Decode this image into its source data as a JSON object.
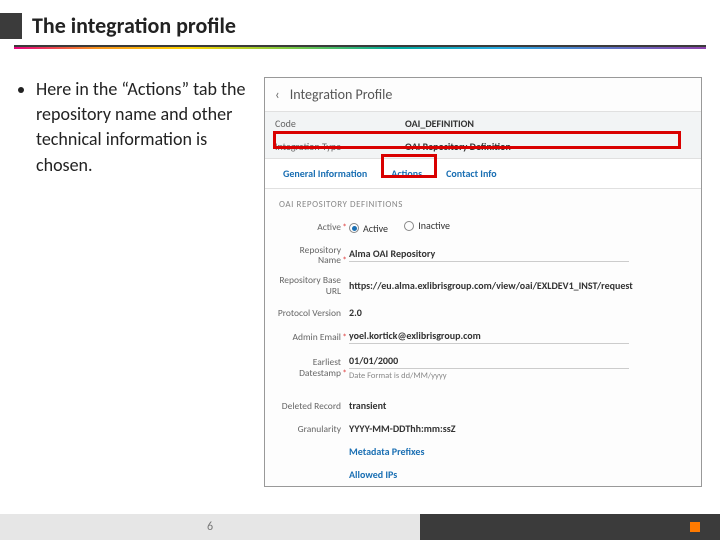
{
  "slide": {
    "title": "The integration profile",
    "bullet": "Here in the “Actions” tab the repository name and other technical information is chosen.",
    "page_number": "6"
  },
  "screenshot": {
    "back_label": "‹",
    "header_title": "Integration Profile",
    "summary": {
      "code_label": "Code",
      "code_value": "OAI_DEFINITION",
      "type_label": "Integration Type",
      "type_value": "OAI Repository Definition"
    },
    "tabs": {
      "general": "General Information",
      "actions": "Actions",
      "contact": "Contact Info"
    },
    "section_heading": "OAI REPOSITORY DEFINITIONS",
    "fields": {
      "active": {
        "label": "Active",
        "opt_active": "Active",
        "opt_inactive": "Inactive"
      },
      "repo_name": {
        "label": "Repository Name",
        "value": "Alma OAI Repository"
      },
      "base_url": {
        "label": "Repository Base URL",
        "value": "https://eu.alma.exlibrisgroup.com/view/oai/EXLDEV1_INST/request"
      },
      "protocol": {
        "label": "Protocol Version",
        "value": "2.0"
      },
      "admin_email": {
        "label": "Admin Email",
        "value": "yoel.kortick@exlibrisgroup.com"
      },
      "earliest": {
        "label": "Earliest Datestamp",
        "value": "01/01/2000",
        "help": "Date Format is dd/MM/yyyy"
      },
      "deleted": {
        "label": "Deleted Record",
        "value": "transient"
      },
      "granularity": {
        "label": "Granularity",
        "value": "YYYY-MM-DDThh:mm:ssZ"
      },
      "metadata_prefixes": "Metadata Prefixes",
      "allowed_ips": "Allowed IPs"
    }
  }
}
